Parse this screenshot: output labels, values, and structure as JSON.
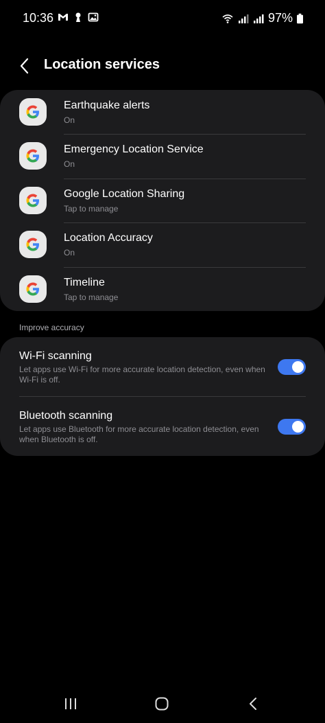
{
  "status_bar": {
    "time": "10:36",
    "battery": "97%",
    "left_icons": [
      "gmail-icon",
      "keyhole-icon",
      "image-icon"
    ],
    "right_icons": [
      "wifi-icon",
      "signal-icon",
      "signal-roaming-icon",
      "battery-icon"
    ]
  },
  "header": {
    "title": "Location services"
  },
  "services": [
    {
      "title": "Earthquake alerts",
      "subtitle": "On"
    },
    {
      "title": "Emergency Location Service",
      "subtitle": "On"
    },
    {
      "title": "Google Location Sharing",
      "subtitle": "Tap to manage"
    },
    {
      "title": "Location Accuracy",
      "subtitle": "On"
    },
    {
      "title": "Timeline",
      "subtitle": "Tap to manage"
    }
  ],
  "accuracy": {
    "section_label": "Improve accuracy",
    "items": [
      {
        "title": "Wi-Fi scanning",
        "description": "Let apps use Wi-Fi for more accurate location detection, even when Wi-Fi is off.",
        "enabled": true
      },
      {
        "title": "Bluetooth scanning",
        "description": "Let apps use Bluetooth for more accurate location detection, even when Bluetooth is off.",
        "enabled": true
      }
    ]
  },
  "colors": {
    "background": "#000000",
    "card": "#1c1c1e",
    "toggle_on": "#3e78f0",
    "subtext": "#8e8e93",
    "google_icon_bg": "#e9e9e9"
  },
  "nav": {
    "icons": [
      "recents-icon",
      "home-icon",
      "back-icon"
    ]
  }
}
